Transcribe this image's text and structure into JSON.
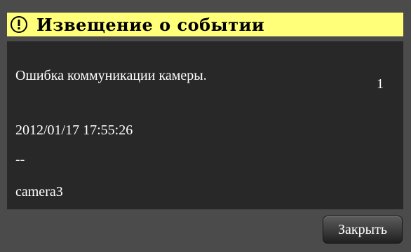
{
  "dialog": {
    "title": "Извещение о событии",
    "icon": "alert-circle-icon",
    "title_bar_color": "#ffff7a",
    "content_bg_color": "#282828"
  },
  "event": {
    "message": "Ошибка коммуникации камеры.",
    "count": "1",
    "timestamp": "2012/01/17 17:55:26",
    "detail": "--",
    "camera": "camera3"
  },
  "buttons": {
    "close_label": "Закрыть"
  }
}
